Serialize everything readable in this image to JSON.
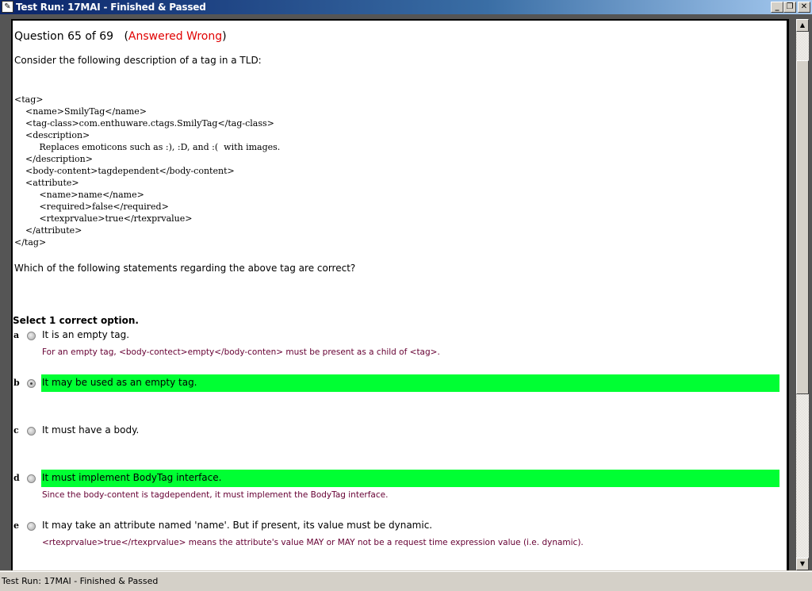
{
  "window": {
    "title": "Test Run: 17MAI  - Finished & Passed",
    "minimize": "_",
    "restore": "❐",
    "close": "✕"
  },
  "question": {
    "header": "Question 65 of 69",
    "status": "Answered Wrong",
    "intro": "Consider the following description of a tag in a TLD:",
    "code": "<tag>\n    <name>SmilyTag</name>\n    <tag-class>com.enthuware.ctags.SmilyTag</tag-class>\n    <description>\n         Replaces emoticons such as :), :D, and :(  with images.\n    </description>\n    <body-content>tagdependent</body-content>\n    <attribute>\n         <name>name</name>\n         <required>false</required>\n         <rtexprvalue>true</rtexprvalue>\n    </attribute>\n</tag>",
    "prompt": "Which of the following statements regarding the above tag are correct?",
    "select_label": "Select 1 correct option."
  },
  "options": [
    {
      "letter": "a",
      "text": "It is an empty tag.",
      "explanation": "For an empty tag, <body-contect>empty</body-conten> must be present as a child of <tag>.",
      "correct": false,
      "selected": false
    },
    {
      "letter": "b",
      "text": "It may be used as an empty tag.",
      "explanation": "",
      "correct": true,
      "selected": true
    },
    {
      "letter": "c",
      "text": "It must have a body.",
      "explanation": "",
      "correct": false,
      "selected": false
    },
    {
      "letter": "d",
      "text": "It must implement BodyTag interface.",
      "explanation": "Since the body-content is tagdependent, it must implement the BodyTag interface.",
      "correct": true,
      "selected": false
    },
    {
      "letter": "e",
      "text": "It may take an attribute named 'name'. But if present, its value must be dynamic.",
      "explanation": "<rtexprvalue>true</rtexprvalue> means the attribute's value MAY or MAY not be a request time expression value (i.e. dynamic).",
      "correct": false,
      "selected": false
    }
  ],
  "colors": {
    "correct_highlight": "#00ff33",
    "wrong": "#e00000",
    "explanation": "#660033"
  },
  "statusbar": {
    "text": "Test Run: 17MAI - Finished & Passed"
  }
}
